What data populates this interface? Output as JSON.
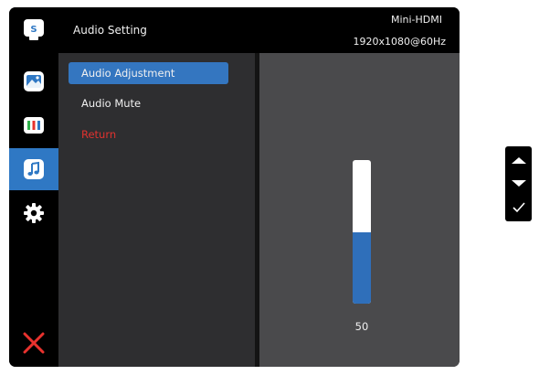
{
  "header": {
    "title": "Audio Setting",
    "input_source": "Mini-HDMI",
    "resolution": "1920x1080@60Hz",
    "logo_letter": "S"
  },
  "sidebar": {
    "items": [
      {
        "icon": "picture-icon",
        "active": false
      },
      {
        "icon": "color-bars-icon",
        "active": false
      },
      {
        "icon": "music-note-icon",
        "active": true
      },
      {
        "icon": "gear-icon",
        "active": false
      }
    ],
    "exit_icon": "close-icon"
  },
  "menu": {
    "items": [
      {
        "label": "Audio Adjustment",
        "selected": true
      },
      {
        "label": "Audio Mute",
        "selected": false
      },
      {
        "label": "Return",
        "selected": false
      }
    ]
  },
  "slider": {
    "value": 50,
    "value_label": "50",
    "min": 0,
    "max": 100
  },
  "keypad": {
    "keys": [
      "up-arrow-icon",
      "down-arrow-icon",
      "check-icon"
    ]
  },
  "colors": {
    "accent": "#2f78c4",
    "return_red": "#e0322f",
    "exit_red": "#e8322e"
  }
}
